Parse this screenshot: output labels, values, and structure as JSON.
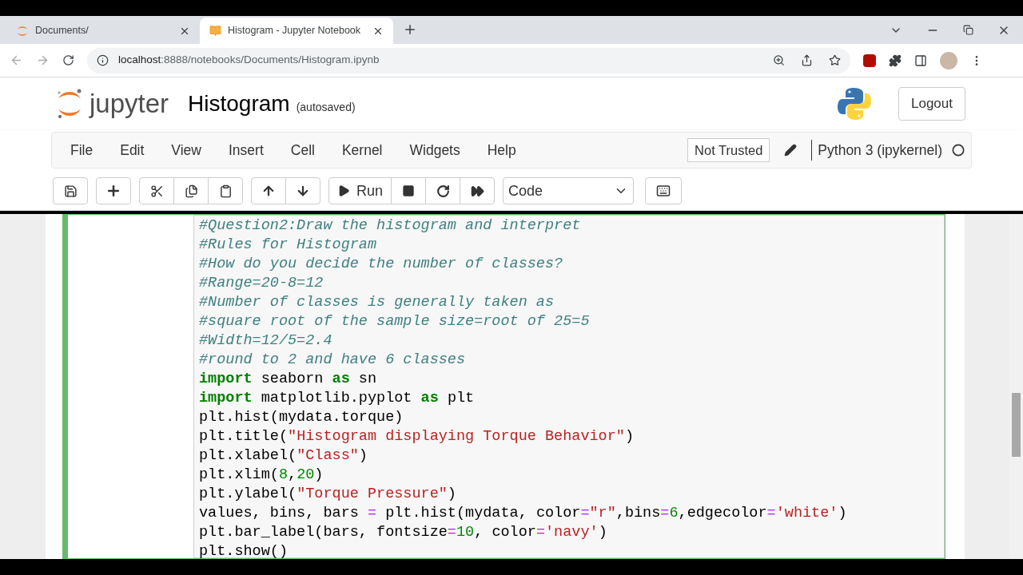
{
  "browser": {
    "tabs": [
      {
        "title": "Documents/",
        "selected": false
      },
      {
        "title": "Histogram - Jupyter Notebook",
        "selected": true
      }
    ],
    "url": {
      "host": "localhost",
      "path": ":8888/notebooks/Documents/Histogram.ipynb"
    }
  },
  "header": {
    "logo_text": "jupyter",
    "notebook_name": "Histogram",
    "save_status": "(autosaved)",
    "logout": "Logout"
  },
  "menu": {
    "items": [
      "File",
      "Edit",
      "View",
      "Insert",
      "Cell",
      "Kernel",
      "Widgets",
      "Help"
    ],
    "trust": "Not Trusted",
    "kernel": "Python 3 (ipykernel)"
  },
  "toolbar": {
    "run": "Run",
    "cell_type": "Code"
  },
  "cell": {
    "selected": true,
    "lines": [
      [
        {
          "kind": "comment",
          "text": "#Question2:Draw the histogram and interpret"
        }
      ],
      [
        {
          "kind": "comment",
          "text": "#Rules for Histogram"
        }
      ],
      [
        {
          "kind": "comment",
          "text": "#How do you decide the number of classes?"
        }
      ],
      [
        {
          "kind": "comment",
          "text": "#Range=20-8=12"
        }
      ],
      [
        {
          "kind": "comment",
          "text": "#Number of classes is generally taken as"
        }
      ],
      [
        {
          "kind": "comment",
          "text": "#square root of the sample size=root of 25=5"
        }
      ],
      [
        {
          "kind": "comment",
          "text": "#Width=12/5=2.4"
        }
      ],
      [
        {
          "kind": "comment",
          "text": "#round to 2 and have 6 classes"
        }
      ],
      [
        {
          "kind": "keyword",
          "text": "import"
        },
        {
          "kind": "plain",
          "text": " seaborn "
        },
        {
          "kind": "keyword",
          "text": "as"
        },
        {
          "kind": "plain",
          "text": " sn"
        }
      ],
      [
        {
          "kind": "keyword",
          "text": "import"
        },
        {
          "kind": "plain",
          "text": " matplotlib.pyplot "
        },
        {
          "kind": "keyword",
          "text": "as"
        },
        {
          "kind": "plain",
          "text": " plt"
        }
      ],
      [
        {
          "kind": "plain",
          "text": "plt.hist(mydata.torque)"
        }
      ],
      [
        {
          "kind": "plain",
          "text": "plt.title("
        },
        {
          "kind": "string",
          "text": "\"Histogram displaying Torque Behavior\""
        },
        {
          "kind": "plain",
          "text": ")"
        }
      ],
      [
        {
          "kind": "plain",
          "text": "plt.xlabel("
        },
        {
          "kind": "string",
          "text": "\"Class\""
        },
        {
          "kind": "plain",
          "text": ")"
        }
      ],
      [
        {
          "kind": "plain",
          "text": "plt.xlim("
        },
        {
          "kind": "number",
          "text": "8"
        },
        {
          "kind": "plain",
          "text": ","
        },
        {
          "kind": "number",
          "text": "20"
        },
        {
          "kind": "plain",
          "text": ")"
        }
      ],
      [
        {
          "kind": "plain",
          "text": "plt.ylabel("
        },
        {
          "kind": "string",
          "text": "\"Torque Pressure\""
        },
        {
          "kind": "plain",
          "text": ")"
        }
      ],
      [
        {
          "kind": "plain",
          "text": "values, bins, bars "
        },
        {
          "kind": "operator",
          "text": "="
        },
        {
          "kind": "plain",
          "text": " plt.hist(mydata, color"
        },
        {
          "kind": "operator",
          "text": "="
        },
        {
          "kind": "string",
          "text": "\"r\""
        },
        {
          "kind": "plain",
          "text": ",bins"
        },
        {
          "kind": "operator",
          "text": "="
        },
        {
          "kind": "number",
          "text": "6"
        },
        {
          "kind": "plain",
          "text": ",edgecolor"
        },
        {
          "kind": "operator",
          "text": "="
        },
        {
          "kind": "string",
          "text": "'white'"
        },
        {
          "kind": "plain",
          "text": ")"
        }
      ],
      [
        {
          "kind": "plain",
          "text": "plt.bar_label(bars, fontsize"
        },
        {
          "kind": "operator",
          "text": "="
        },
        {
          "kind": "number",
          "text": "10"
        },
        {
          "kind": "plain",
          "text": ", color"
        },
        {
          "kind": "operator",
          "text": "="
        },
        {
          "kind": "string",
          "text": "'navy'"
        },
        {
          "kind": "plain",
          "text": ")"
        }
      ],
      [
        {
          "kind": "plain",
          "text": "plt.show()"
        }
      ]
    ]
  }
}
